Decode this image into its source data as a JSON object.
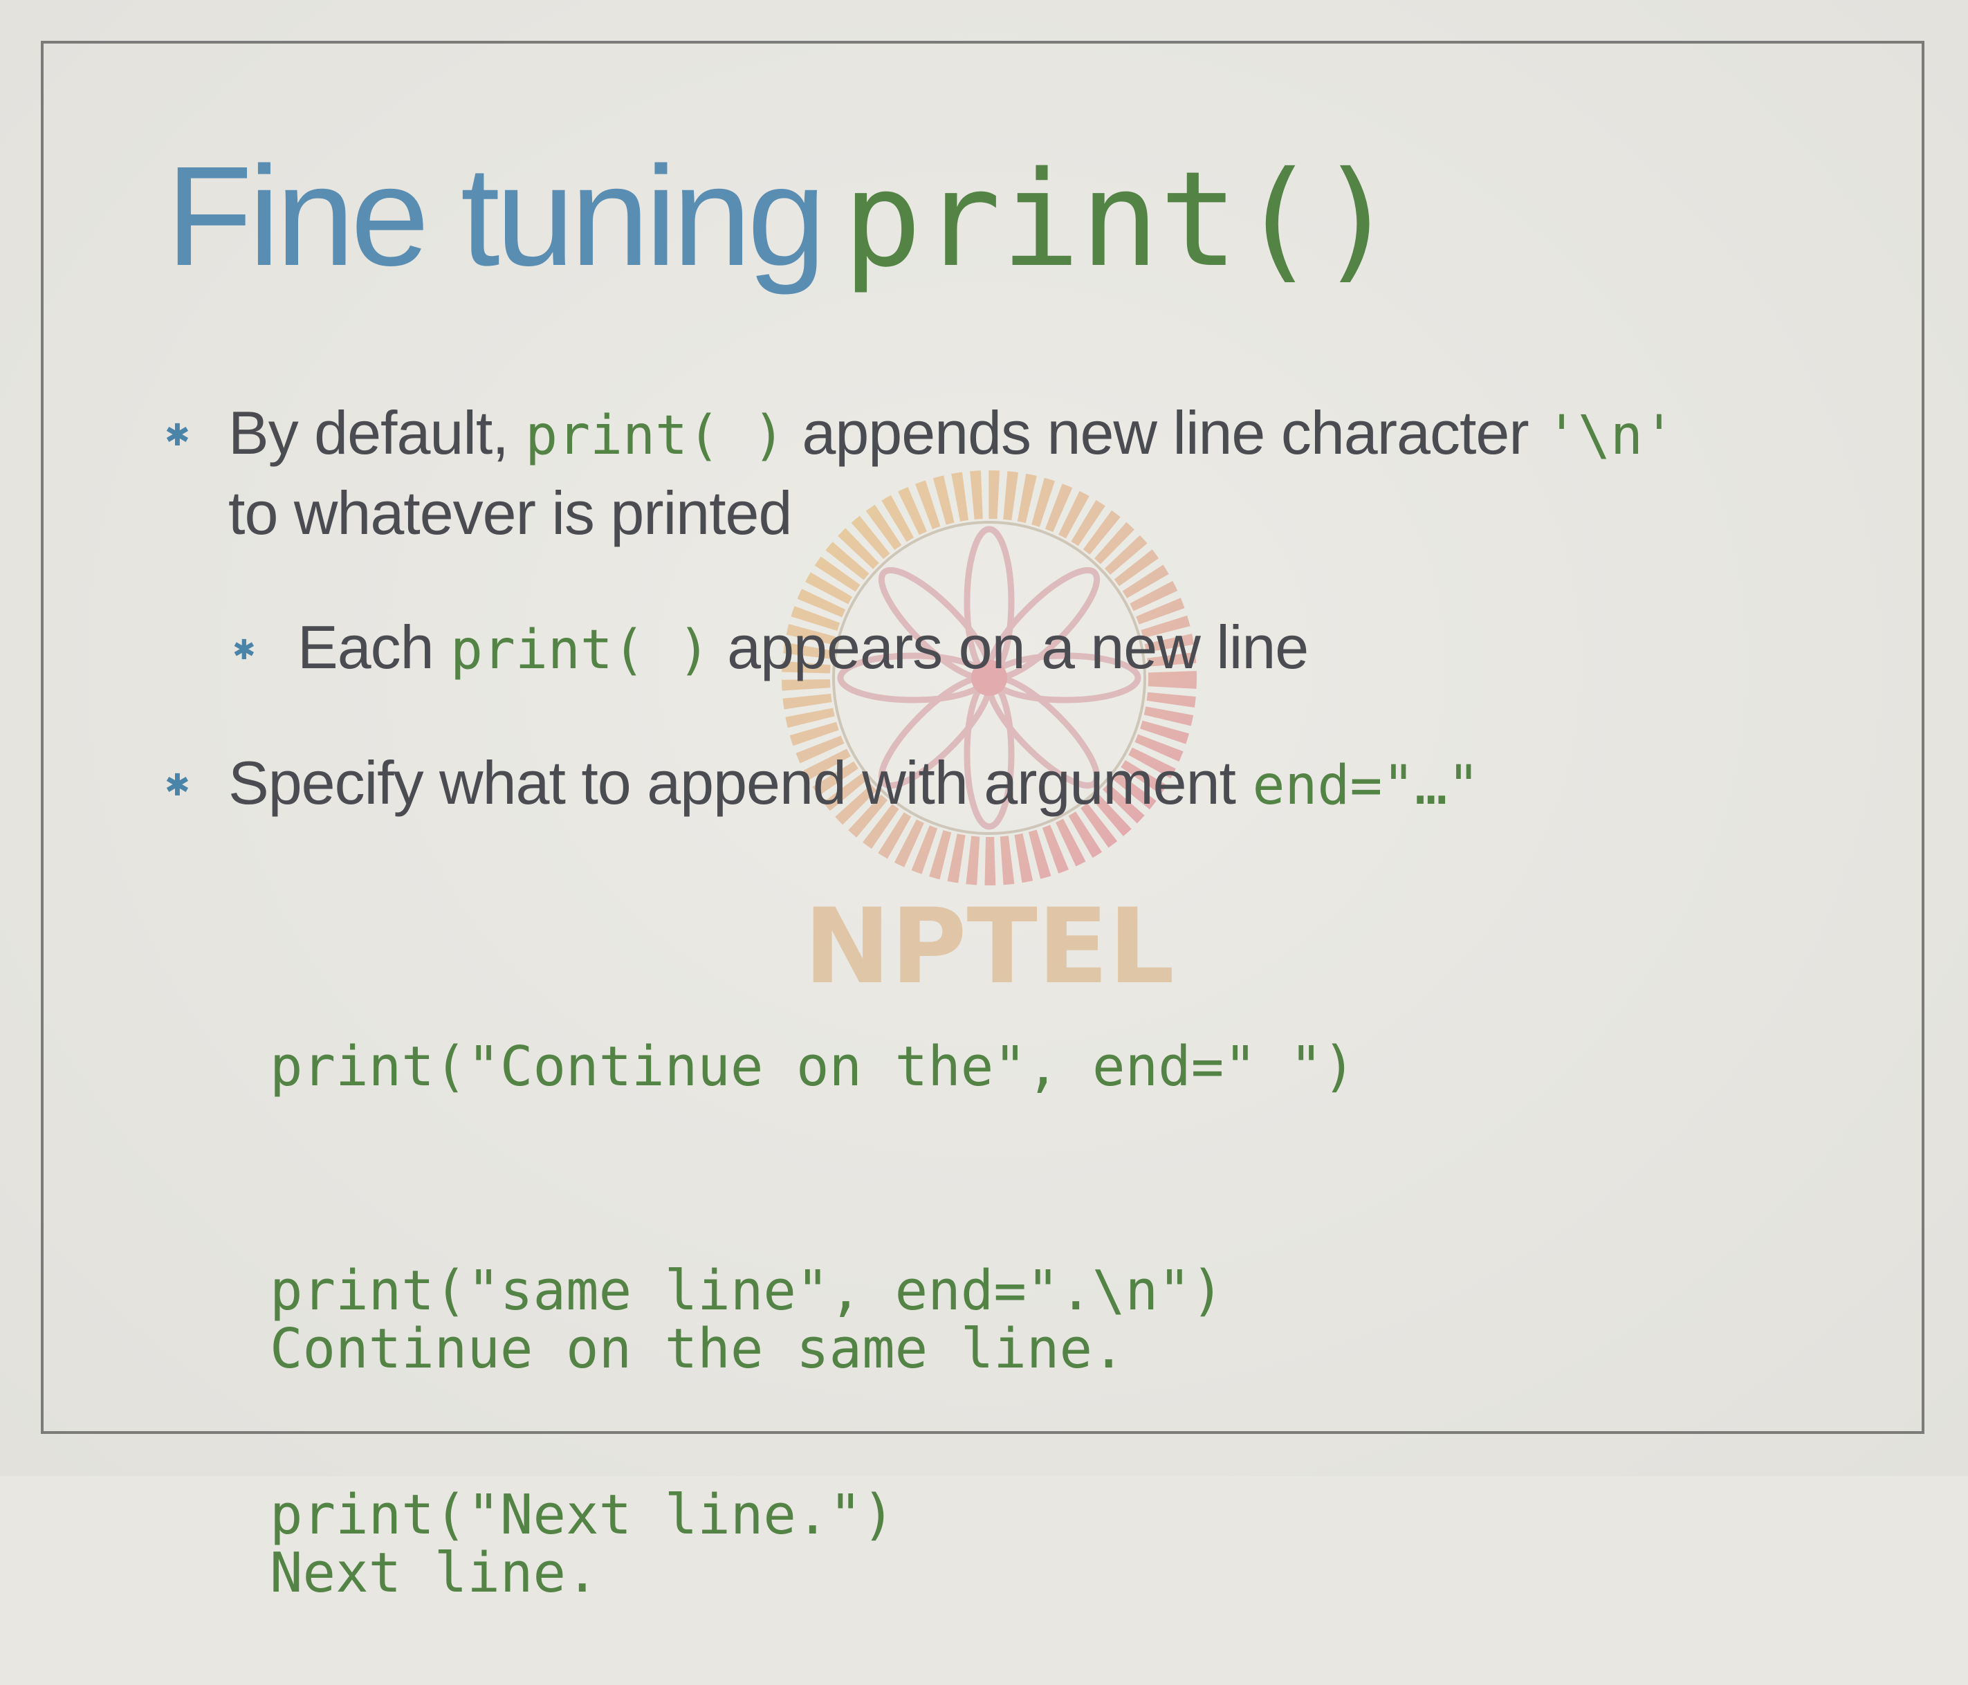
{
  "slide": {
    "title_text": "Fine tuning",
    "title_code": "print()",
    "bullets": [
      {
        "seg1": "By default,",
        "code1": "print( )",
        "seg2": "appends new line character",
        "code2": "'\\n'",
        "line2": "to whatever is printed"
      },
      {
        "seg1": "Each",
        "code1": "print( )",
        "seg2": "appears on a new line"
      },
      {
        "seg1": "Specify what to append with argument",
        "code1": "end=\"…\""
      }
    ],
    "code": [
      "print(\"Continue on the\", end=\" \")",
      "print(\"same line\", end=\".\\n\")",
      "print(\"Next line.\")"
    ],
    "output": [
      "Continue on the same line.",
      "Next line."
    ],
    "watermark_text": "NPTEL"
  },
  "colors": {
    "title_blue": "#5a8db2",
    "code_green": "#538345",
    "body_text": "#4a4c52",
    "bullet_blue": "#4a84a8",
    "frame": "#7b7b7a"
  },
  "icons": {
    "bullet": "asterisk-bullet-icon",
    "watermark": "nptel-logo-icon"
  }
}
